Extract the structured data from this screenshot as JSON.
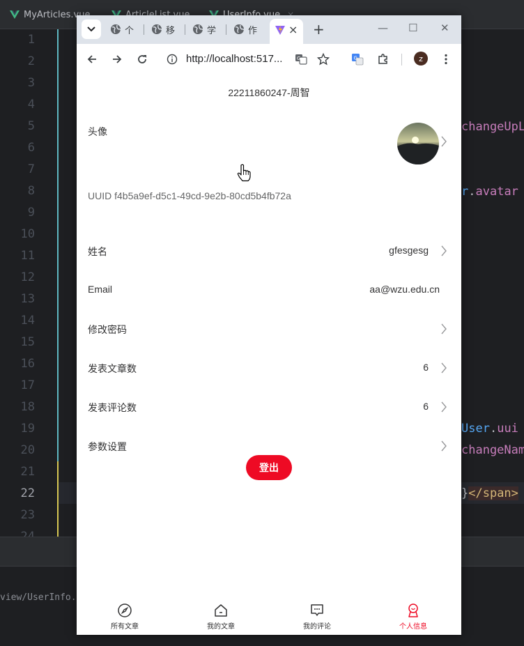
{
  "ide": {
    "tabs": [
      {
        "name": "MyArticles.vue",
        "close": ""
      },
      {
        "name": "ArticleList.vue",
        "close": ""
      },
      {
        "name": "UserInfo.vue",
        "close": "×"
      }
    ],
    "line_numbers": [
      "1",
      "2",
      "3",
      "4",
      "5",
      "6",
      "7",
      "8",
      "9",
      "10",
      "11",
      "12",
      "13",
      "14",
      "15",
      "16",
      "17",
      "18",
      "19",
      "20",
      "21",
      "22",
      "23",
      "24"
    ],
    "code_fragments": {
      "line5": "changeUpL",
      "line8_var": "r",
      "line8_dot": ".",
      "line8_prop": "avatar",
      "line19_var": "User",
      "line19_dot": ".",
      "line19_prop": "uui",
      "line20": "changeNam",
      "line22_brace": "}",
      "line22_tag": "</span>"
    },
    "file_path": "view/UserInfo."
  },
  "browser": {
    "tabs": [
      {
        "label": "个"
      },
      {
        "label": "移"
      },
      {
        "label": "学"
      },
      {
        "label": "作"
      }
    ],
    "active_tab_close": "×",
    "new_tab": "+",
    "window_controls": {
      "minimize": "—",
      "maximize": "☐",
      "close": "✕"
    },
    "url": "http://localhost:517...",
    "profile_initial": "z"
  },
  "app": {
    "nav_title": "22211860247-周智",
    "avatar_label": "头像",
    "uuid_text": "UUID f4b5a9ef-d5c1-49cd-9e2b-80cd5b4fb72a",
    "name_label": "姓名",
    "name_value": "gfesgesg",
    "email_label": "Email",
    "email_value": "aa@wzu.edu.cn",
    "password_label": "修改密码",
    "articles_label": "发表文章数",
    "articles_value": "6",
    "comments_label": "发表评论数",
    "comments_value": "6",
    "settings_label": "参数设置",
    "logout_label": "登出",
    "tabbar": [
      {
        "label": "所有文章"
      },
      {
        "label": "我的文章"
      },
      {
        "label": "我的评论"
      },
      {
        "label": "个人信息"
      }
    ],
    "accent_color": "#ee0a24"
  }
}
